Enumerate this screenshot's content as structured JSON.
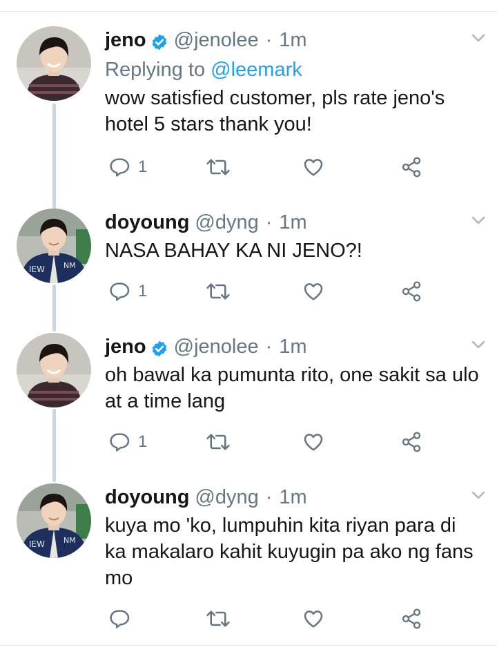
{
  "tweets": [
    {
      "name": "jeno",
      "verified": true,
      "handle": "@jenolee",
      "time": "1m",
      "replying_label": "Replying to",
      "replying_to": "@leemark",
      "text": "wow satisfied customer, pls rate jeno's hotel 5 stars thank you!",
      "reply_count": "1"
    },
    {
      "name": "doyoung",
      "verified": false,
      "handle": "@dyng",
      "time": "1m",
      "text": "NASA BAHAY KA NI JENO?!",
      "reply_count": "1"
    },
    {
      "name": "jeno",
      "verified": true,
      "handle": "@jenolee",
      "time": "1m",
      "text": "oh bawal ka pumunta rito, one sakit sa ulo at a time lang",
      "reply_count": "1"
    },
    {
      "name": "doyoung",
      "verified": false,
      "handle": "@dyng",
      "time": "1m",
      "text": "kuya mo 'ko, lumpuhin kita riyan para di ka makalaro kahit kuyugin pa ako ng fans mo",
      "reply_count": ""
    }
  ],
  "header_separator": "·",
  "colors": {
    "link": "#1da1f2",
    "secondary": "#657786",
    "thread_line": "#ccd6dd",
    "verified": "#1da1f2"
  },
  "icons": [
    "reply-icon",
    "retweet-icon",
    "like-icon",
    "share-icon",
    "chevron-down-icon",
    "verified-badge-icon"
  ]
}
